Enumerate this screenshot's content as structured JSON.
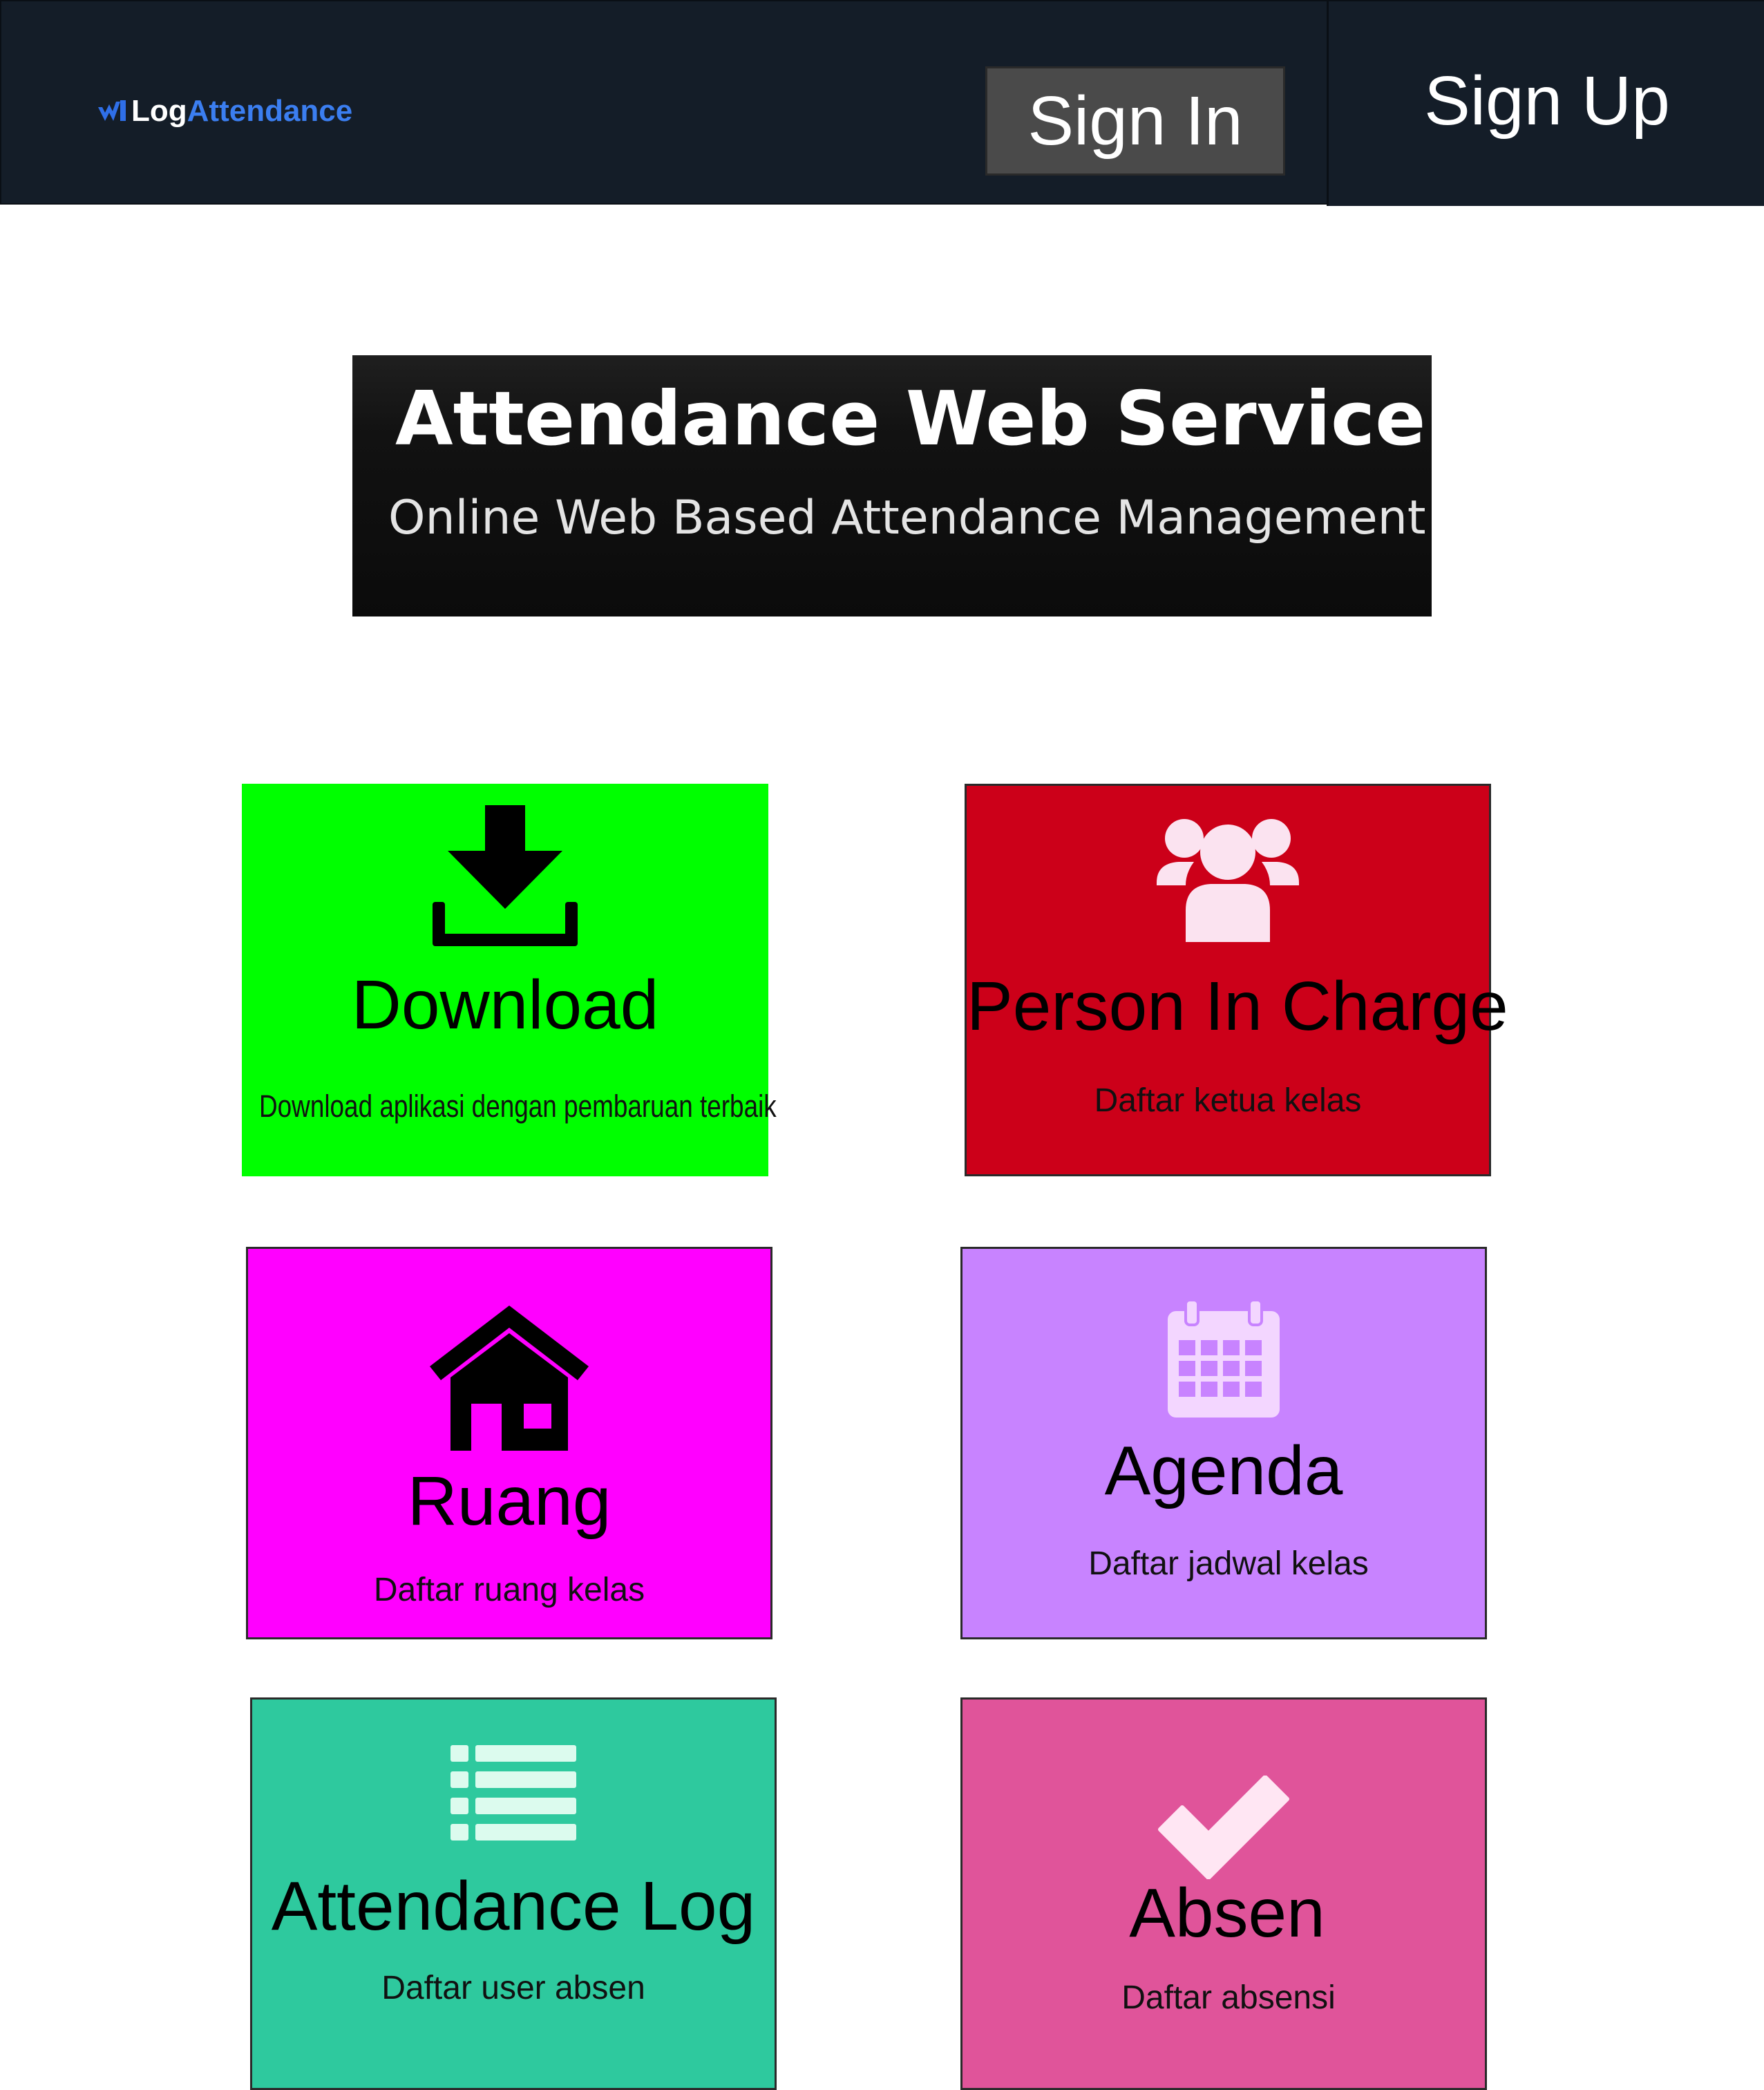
{
  "navbar": {
    "logo_part1": "Log",
    "logo_part2": "Attendance",
    "signin_label": "Sign In",
    "signup_label": "Sign Up",
    "background": "#141d28",
    "logo_accent": "#3b7ef0"
  },
  "banner": {
    "title": "Attendance Web Service",
    "subtitle": "Online Web Based Attendance Management"
  },
  "cards": [
    {
      "title": "Download",
      "desc": "Download aplikasi dengan pembaruan terbaik",
      "color": "#00ff00",
      "icon": "download-icon"
    },
    {
      "title": "Person In Charge",
      "desc": "Daftar ketua kelas",
      "color": "#cc0019",
      "icon": "users-icon"
    },
    {
      "title": "Ruang",
      "desc": "Daftar ruang kelas",
      "color": "#ff00ff",
      "icon": "home-icon"
    },
    {
      "title": "Agenda",
      "desc": "Daftar jadwal kelas",
      "color": "#c883ff",
      "icon": "calendar-icon"
    },
    {
      "title": "Attendance Log",
      "desc": "Daftar user absen",
      "color": "#2ec99e",
      "icon": "list-icon"
    },
    {
      "title": "Absen",
      "desc": "Daftar absensi",
      "color": "#e0549a",
      "icon": "check-icon"
    }
  ]
}
